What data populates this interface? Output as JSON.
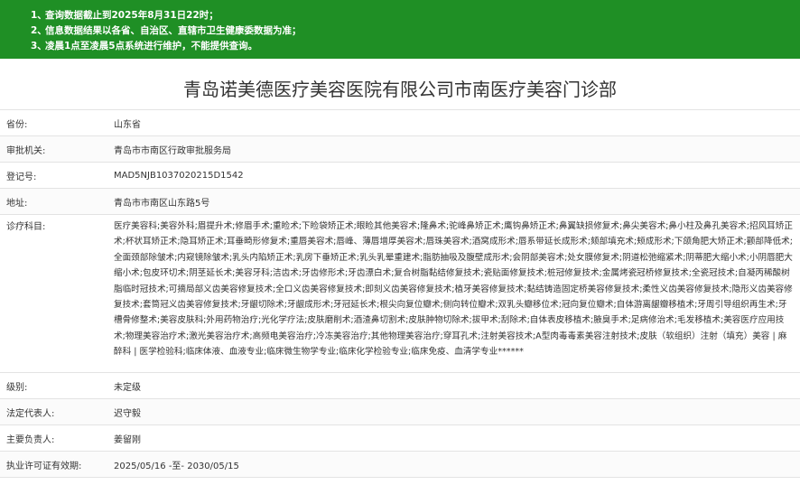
{
  "notice": {
    "lines": [
      {
        "num": "1、",
        "text": "查询数据截止到2025年8月31日22时；"
      },
      {
        "num": "2、",
        "text": "信息数据结果以各省、自治区、直辖市卫生健康委数据为准；"
      },
      {
        "num": "3、",
        "text": "凌晨1点至凌晨5点系统进行维护，不能提供查询。"
      }
    ]
  },
  "title": "青岛诺美德医疗美容医院有限公司市南医疗美容门诊部",
  "rows": [
    {
      "label": "省份:",
      "value": "山东省"
    },
    {
      "label": "审批机关:",
      "value": "青岛市市南区行政审批服务局"
    },
    {
      "label": "登记号:",
      "value": "MAD5NJB1037020215D1542"
    },
    {
      "label": "地址:",
      "value": "青岛市市南区山东路5号"
    },
    {
      "label": "诊疗科目:",
      "value": "医疗美容科;美容外科;眉提升术;修眉手术;重睑术;下睑袋矫正术;眼睑其他美容术;隆鼻术;驼峰鼻矫正术;鹰钩鼻矫正术;鼻翼缺损修复术;鼻尖美容术;鼻小柱及鼻孔美容术;招风耳矫正术;杯状耳矫正术;隐耳矫正术;耳垂畸形修复术;重唇美容术;唇峰、薄唇增厚美容术;唇珠美容术;酒窝成形术;唇系带延长成形术;颏部填充术;颊成形术;下颌角肥大矫正术;颧部降低术;全面颈部除皱术;内窥镜除皱术;乳头内陷矫正术;乳房下垂矫正术;乳头乳晕重建术;脂肪抽吸及腹壁成形术;会阴部美容术;处女膜修复术;阴道松弛缩紧术;阴蒂肥大缩小术;小阴唇肥大缩小术;包皮环切术;阴茎延长术;美容牙科;洁齿术;牙齿修形术;牙齿漂白术;复合树脂黏结修复技术;瓷贴面修复技术;桩冠修复技术;金属烤瓷冠桥修复技术;全瓷冠技术;自凝丙稀酸树脂临时冠技术;可摘局部义齿美容修复技术;全口义齿美容修复技术;即刻义齿美容修复技术;植牙美容修复技术;黏结铸造固定桥美容修复技术;柔性义齿美容修复技术;隐形义齿美容修复技术;套筒冠义齿美容修复技术;牙龈切除术;牙龈成形术;牙冠延长术;根尖向复位瓣术;侧向转位瓣术;双乳头瓣移位术;冠向复位瓣术;自体游离龈瓣移植术;牙周引导组织再生术;牙槽骨修整术;美容皮肤科;外用药物治疗;光化学疗法;皮肤磨削术;酒渣鼻切割术;皮肤肿物切除术;拔甲术;刮除术;自体表皮移植术;腋臭手术;足病修治术;毛发移植术;美容医疗应用技术;物理美容治疗术;激光美容治疗术;高频电美容治疗;冷冻美容治疗;其他物理美容治疗;穿耳孔术;注射美容技术;A型肉毒毒素美容注射技术;皮肤（软组织）注射（填充）美容 | 麻醉科 | 医学检验科;临床体液、血液专业;临床微生物学专业;临床化学检验专业;临床免疫、血清学专业******"
    },
    {
      "label": "级别:",
      "value": "未定级"
    },
    {
      "label": "法定代表人:",
      "value": "迟守毅"
    },
    {
      "label": "主要负责人:",
      "value": "姜留刚"
    },
    {
      "label": "执业许可证有效期:",
      "value": "2025/05/16 -至- 2030/05/15"
    }
  ]
}
